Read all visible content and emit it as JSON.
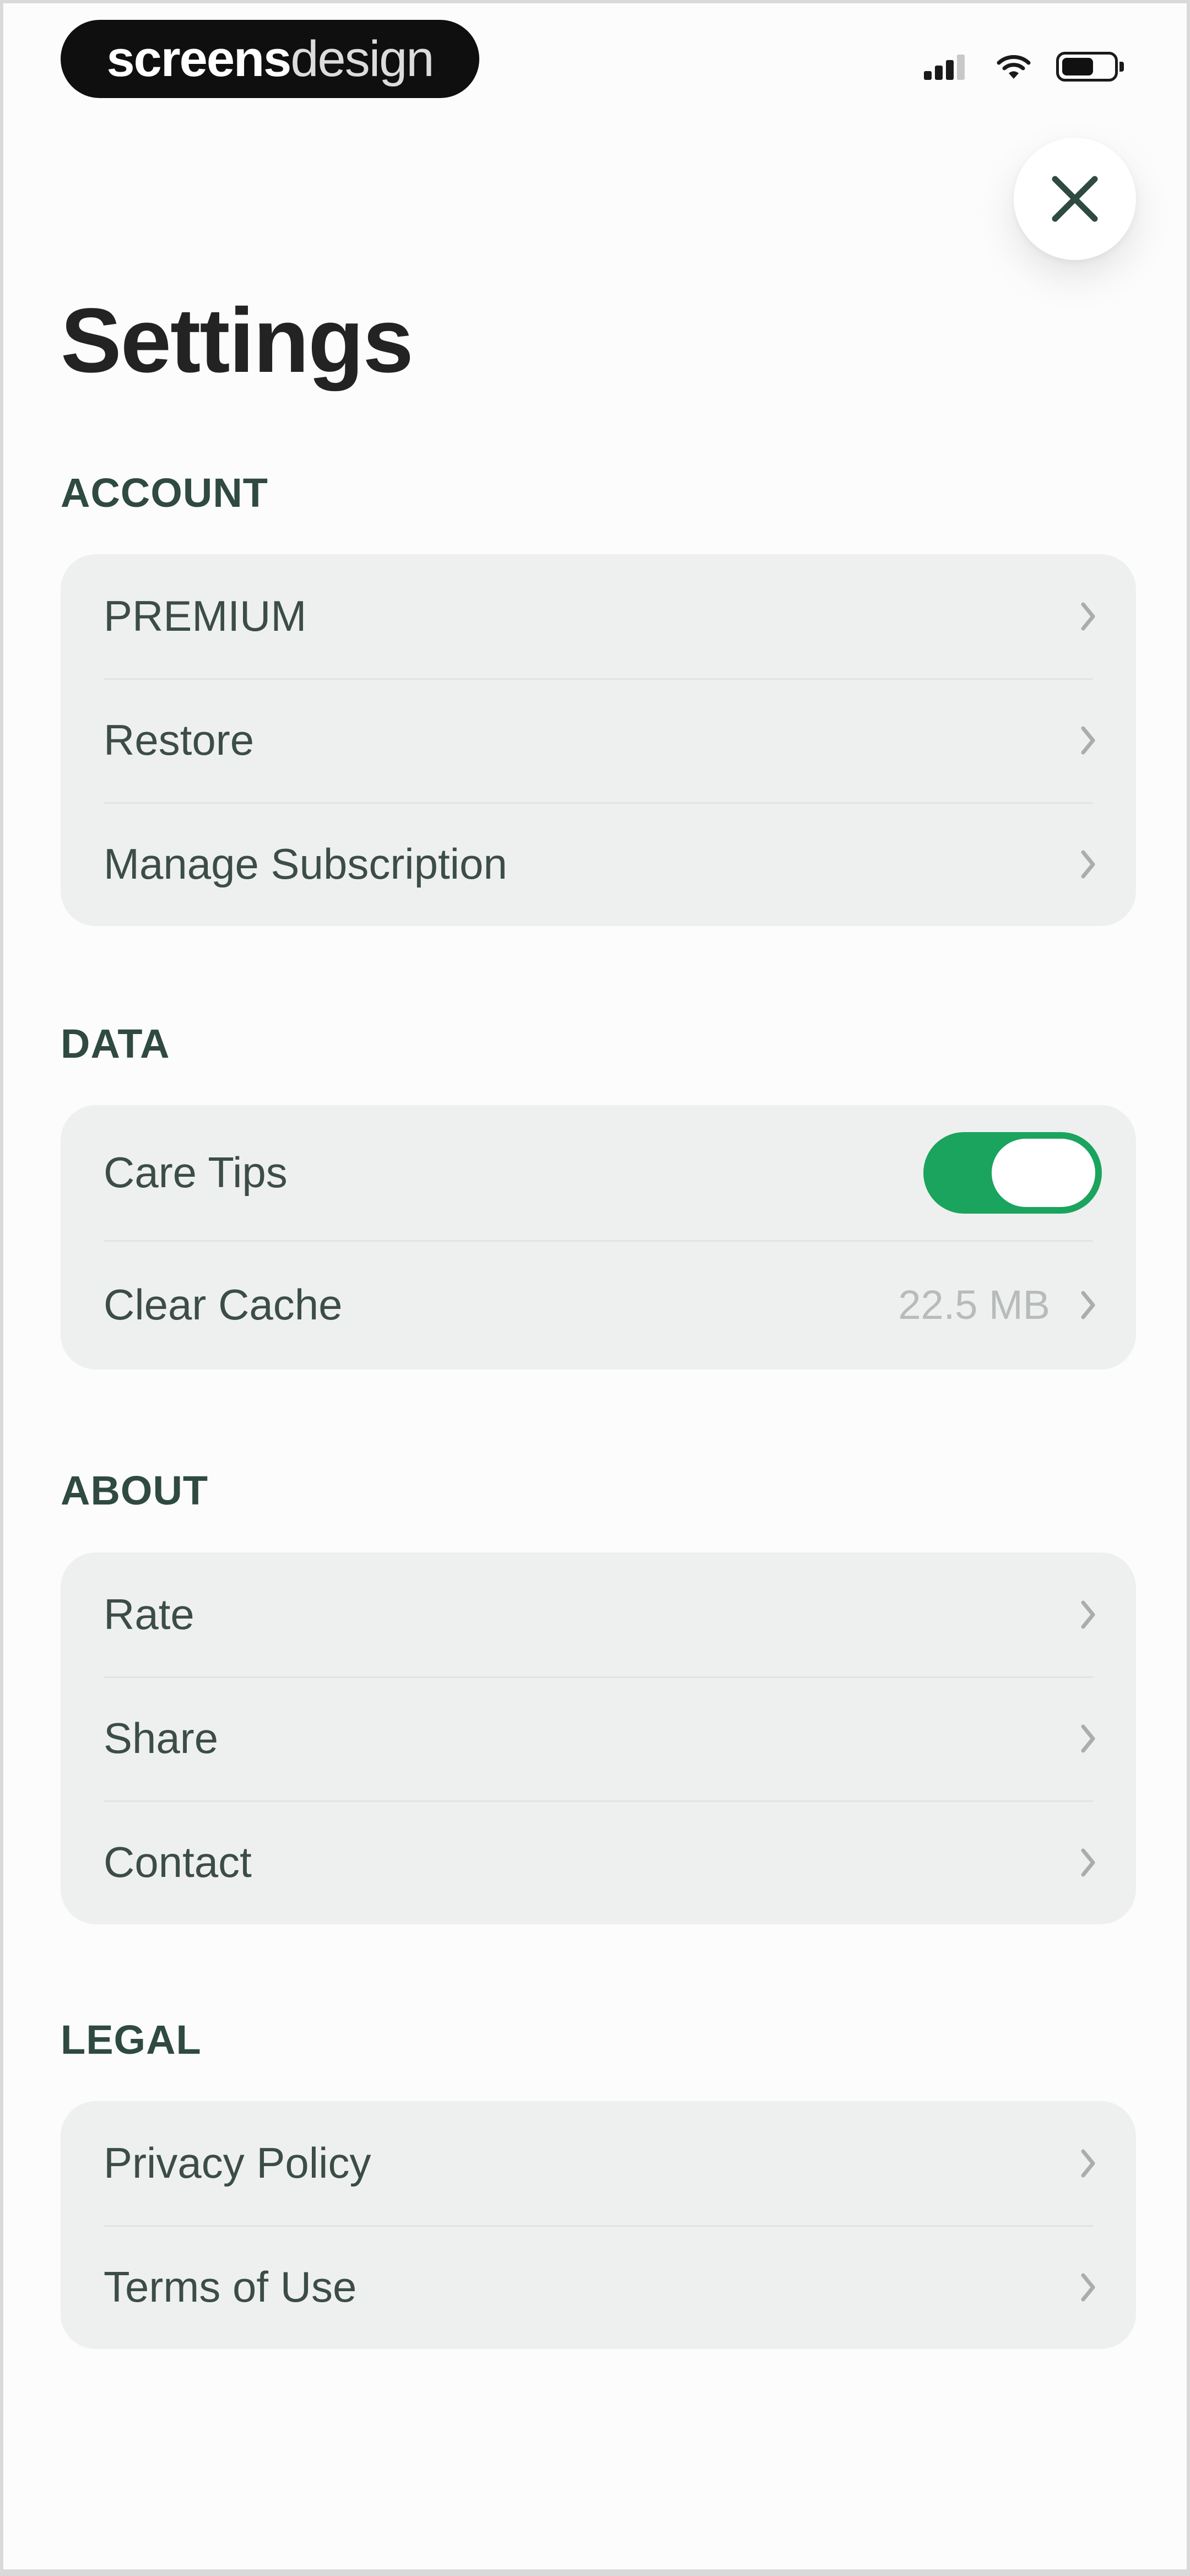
{
  "status_bar": {
    "brand": {
      "bold": "screens",
      "light": "design"
    },
    "icons": [
      "signal-icon",
      "wifi-icon",
      "battery-icon"
    ],
    "battery_level": 0.64
  },
  "close": {
    "icon": "close-icon"
  },
  "title": "Settings",
  "colors": {
    "accent": "#1aa45d",
    "section_header": "#2f4a40",
    "card_background": "#eef0ef",
    "row_text": "#3c4d46",
    "secondary_text": "#b7bbb9"
  },
  "sections": {
    "account": {
      "header": "ACCOUNT",
      "items": [
        {
          "label": "PREMIUM"
        },
        {
          "label": "Restore"
        },
        {
          "label": "Manage Subscription"
        }
      ]
    },
    "data": {
      "header": "DATA",
      "care_tips": {
        "label": "Care Tips",
        "toggle_on": true
      },
      "clear_cache": {
        "label": "Clear Cache",
        "value": "22.5 MB"
      }
    },
    "about": {
      "header": "ABOUT",
      "items": [
        {
          "label": "Rate"
        },
        {
          "label": "Share"
        },
        {
          "label": "Contact"
        }
      ]
    },
    "legal": {
      "header": "LEGAL",
      "items": [
        {
          "label": "Privacy Policy"
        },
        {
          "label": "Terms of Use"
        }
      ]
    }
  }
}
